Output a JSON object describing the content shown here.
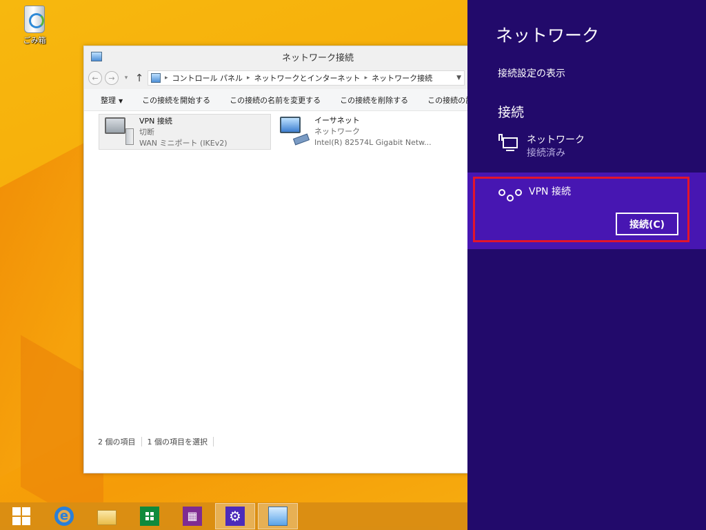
{
  "desktop": {
    "recycle_bin_label": "ごみ箱"
  },
  "explorer": {
    "title": "ネットワーク接続",
    "address": {
      "crumbs": [
        "コントロール パネル",
        "ネットワークとインターネット",
        "ネットワーク接続"
      ]
    },
    "commands": {
      "organize": "整理",
      "start_connection": "この接続を開始する",
      "rename_connection": "この接続の名前を変更する",
      "delete_connection": "この接続を削除する",
      "change_settings": "この接続の設"
    },
    "items": [
      {
        "name": "VPN 接続",
        "status": "切断",
        "device": "WAN ミニポート (IKEv2)"
      },
      {
        "name": "イーサネット",
        "status": "ネットワーク",
        "device": "Intel(R) 82574L Gigabit Netw..."
      }
    ],
    "statusbar": {
      "item_count": "2 個の項目",
      "selected_count": "1 個の項目を選択"
    }
  },
  "charms_pane": {
    "title": "ネットワーク",
    "view_connection_settings": "接続設定の表示",
    "connections_heading": "接続",
    "network": {
      "name": "ネットワーク",
      "status": "接続済み"
    },
    "vpn": {
      "name": "VPN 接続",
      "connect_label": "接続(C)"
    },
    "colors": {
      "pane_bg": "#220a6b",
      "selected_bg": "#4716b2",
      "highlight": "#e3152b"
    }
  },
  "taskbar": {
    "icons": [
      "windows-start-icon",
      "internet-explorer-icon",
      "file-explorer-icon",
      "store-icon",
      "maps-icon",
      "settings-icon",
      "network-connections-icon"
    ]
  }
}
